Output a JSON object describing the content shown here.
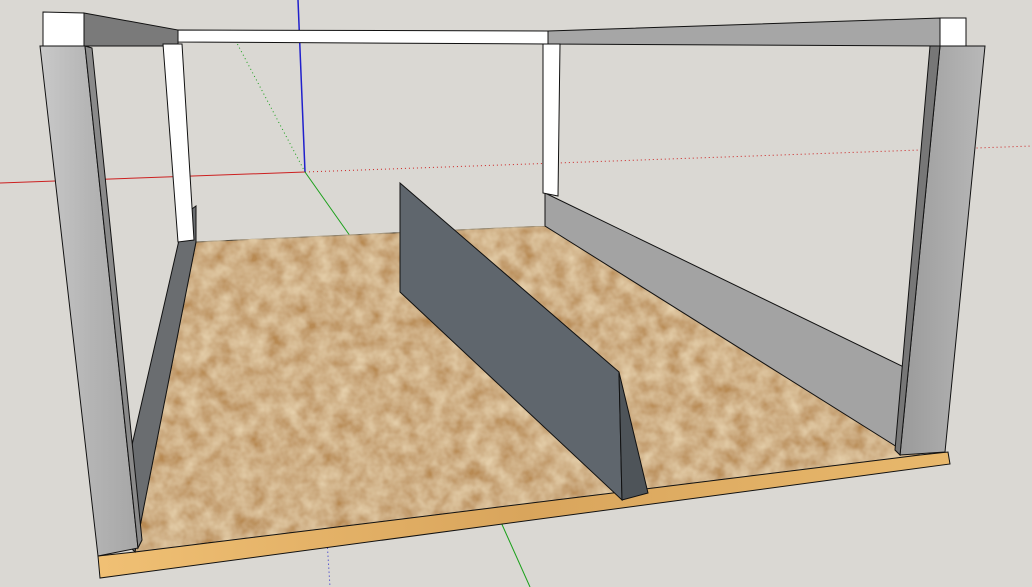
{
  "app": {
    "type": "3d-modeling-viewport"
  },
  "scene": {
    "background": "#dad8d3",
    "axes": {
      "red_axis_color": "#cc2020",
      "green_axis_color": "#1aa01a",
      "blue_axis_color": "#2020cc"
    },
    "floor": {
      "material": "osb-wood-texture",
      "base_color": "#b88a52",
      "edge_color": "#e2b36a"
    },
    "frame": {
      "post_color": "#b4b4b4",
      "beam_top_color": "#ffffff",
      "beam_side_color": "#7a7a7a"
    },
    "panels": {
      "divider_color": "#5f666d",
      "right_wall_color": "#a3a3a3",
      "left_wall_color": "#6a6d70"
    }
  }
}
